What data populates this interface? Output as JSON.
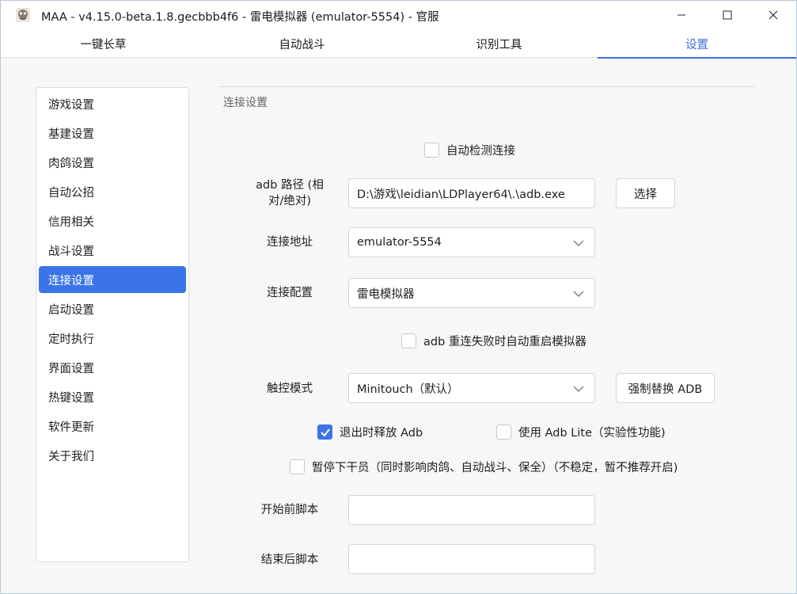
{
  "window": {
    "title": "MAA - v4.15.0-beta.1.8.gecbbb4f6 - 雷电模拟器 (emulator-5554) - 官服",
    "minimize_icon": "minimize-icon",
    "maximize_icon": "maximize-icon",
    "close_icon": "close-icon"
  },
  "tabs": [
    {
      "label": "一键长草",
      "active": false
    },
    {
      "label": "自动战斗",
      "active": false
    },
    {
      "label": "识别工具",
      "active": false
    },
    {
      "label": "设置",
      "active": true
    }
  ],
  "sidebar": {
    "items": [
      {
        "label": "游戏设置",
        "active": false
      },
      {
        "label": "基建设置",
        "active": false
      },
      {
        "label": "肉鸽设置",
        "active": false
      },
      {
        "label": "自动公招",
        "active": false
      },
      {
        "label": "信用相关",
        "active": false
      },
      {
        "label": "战斗设置",
        "active": false
      },
      {
        "label": "连接设置",
        "active": true
      },
      {
        "label": "启动设置",
        "active": false
      },
      {
        "label": "定时执行",
        "active": false
      },
      {
        "label": "界面设置",
        "active": false
      },
      {
        "label": "热键设置",
        "active": false
      },
      {
        "label": "软件更新",
        "active": false
      },
      {
        "label": "关于我们",
        "active": false
      }
    ]
  },
  "connection": {
    "section_title": "连接设置",
    "auto_detect": {
      "label": "自动检测连接",
      "checked": false
    },
    "adb_path": {
      "label_line1": "adb 路径 (相",
      "label_line2": "对/绝对)",
      "value": "D:\\游戏\\leidian\\LDPlayer64\\.\\adb.exe",
      "select_button": "选择"
    },
    "address": {
      "label": "连接地址",
      "value": "emulator-5554"
    },
    "config": {
      "label": "连接配置",
      "value": "雷电模拟器"
    },
    "restart_emulator": {
      "label": "adb 重连失败时自动重启模拟器",
      "checked": false
    },
    "touch_mode": {
      "label": "触控模式",
      "value": "Minitouch（默认）",
      "replace_button": "强制替换 ADB"
    },
    "release_adb": {
      "label": "退出时释放 Adb",
      "checked": true
    },
    "adb_lite": {
      "label": "使用 Adb Lite（实验性功能)",
      "checked": false
    },
    "pause_operator": {
      "label": "暂停下干员（同时影响肉鸽、自动战斗、保全）（不稳定，暂不推荐开启)",
      "checked": false
    },
    "pre_script": {
      "label": "开始前脚本",
      "value": ""
    },
    "post_script": {
      "label": "结束后脚本",
      "value": ""
    }
  },
  "colors": {
    "accent": "#3b74e8",
    "tab_accent": "#3a6fe0",
    "background": "#f7f7f7"
  }
}
